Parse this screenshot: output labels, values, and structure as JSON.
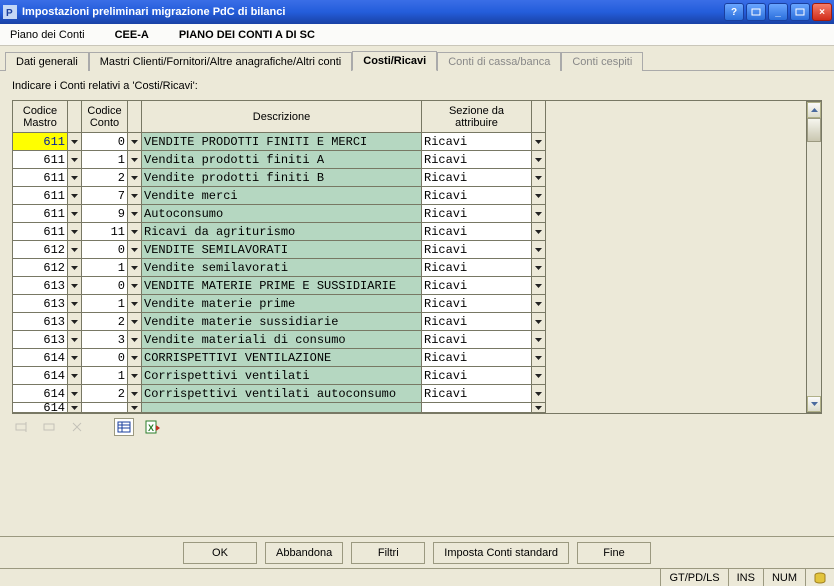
{
  "window": {
    "title": "Impostazioni preliminari migrazione PdC di bilanci"
  },
  "header": {
    "label": "Piano dei Conti",
    "code": "CEE-A",
    "title": "PIANO DEI CONTI A DI SC"
  },
  "tabs": {
    "general": "Dati generali",
    "masters": "Mastri Clienti/Fornitori/Altre anagrafiche/Altri conti",
    "cost": "Costi/Ricavi",
    "cash": "Conti di cassa/banca",
    "assets": "Conti cespiti"
  },
  "panel_title": "Indicare i Conti relativi a 'Costi/Ricavi':",
  "cols": {
    "mastro": "Codice\nMastro",
    "conto": "Codice\nConto",
    "desc": "Descrizione",
    "sez": "Sezione da\nattribuire"
  },
  "rows": [
    {
      "mastro": "611",
      "conto": "0",
      "desc": "VENDITE PRODOTTI FINITI E MERCI",
      "sez": "Ricavi"
    },
    {
      "mastro": "611",
      "conto": "1",
      "desc": "Vendita prodotti finiti A",
      "sez": "Ricavi"
    },
    {
      "mastro": "611",
      "conto": "2",
      "desc": "Vendite prodotti finiti B",
      "sez": "Ricavi"
    },
    {
      "mastro": "611",
      "conto": "7",
      "desc": "Vendite merci",
      "sez": "Ricavi"
    },
    {
      "mastro": "611",
      "conto": "9",
      "desc": "Autoconsumo",
      "sez": "Ricavi"
    },
    {
      "mastro": "611",
      "conto": "11",
      "desc": "Ricavi da agriturismo",
      "sez": "Ricavi"
    },
    {
      "mastro": "612",
      "conto": "0",
      "desc": "VENDITE SEMILAVORATI",
      "sez": "Ricavi"
    },
    {
      "mastro": "612",
      "conto": "1",
      "desc": "Vendite semilavorati",
      "sez": "Ricavi"
    },
    {
      "mastro": "613",
      "conto": "0",
      "desc": "VENDITE MATERIE PRIME E SUSSIDIARIE",
      "sez": "Ricavi"
    },
    {
      "mastro": "613",
      "conto": "1",
      "desc": "Vendite materie prime",
      "sez": "Ricavi"
    },
    {
      "mastro": "613",
      "conto": "2",
      "desc": "Vendite materie sussidiarie",
      "sez": "Ricavi"
    },
    {
      "mastro": "613",
      "conto": "3",
      "desc": "Vendite materiali di consumo",
      "sez": "Ricavi"
    },
    {
      "mastro": "614",
      "conto": "0",
      "desc": "CORRISPETTIVI VENTILAZIONE",
      "sez": "Ricavi"
    },
    {
      "mastro": "614",
      "conto": "1",
      "desc": "Corrispettivi ventilati",
      "sez": "Ricavi"
    },
    {
      "mastro": "614",
      "conto": "2",
      "desc": "Corrispettivi ventilati autoconsumo",
      "sez": "Ricavi"
    }
  ],
  "buttons": {
    "ok": "OK",
    "cancel": "Abbandona",
    "filter": "Filtri",
    "std": "Imposta Conti standard",
    "end": "Fine"
  },
  "status": {
    "path": "GT/PD/LS",
    "ins": "INS",
    "num": "NUM"
  }
}
